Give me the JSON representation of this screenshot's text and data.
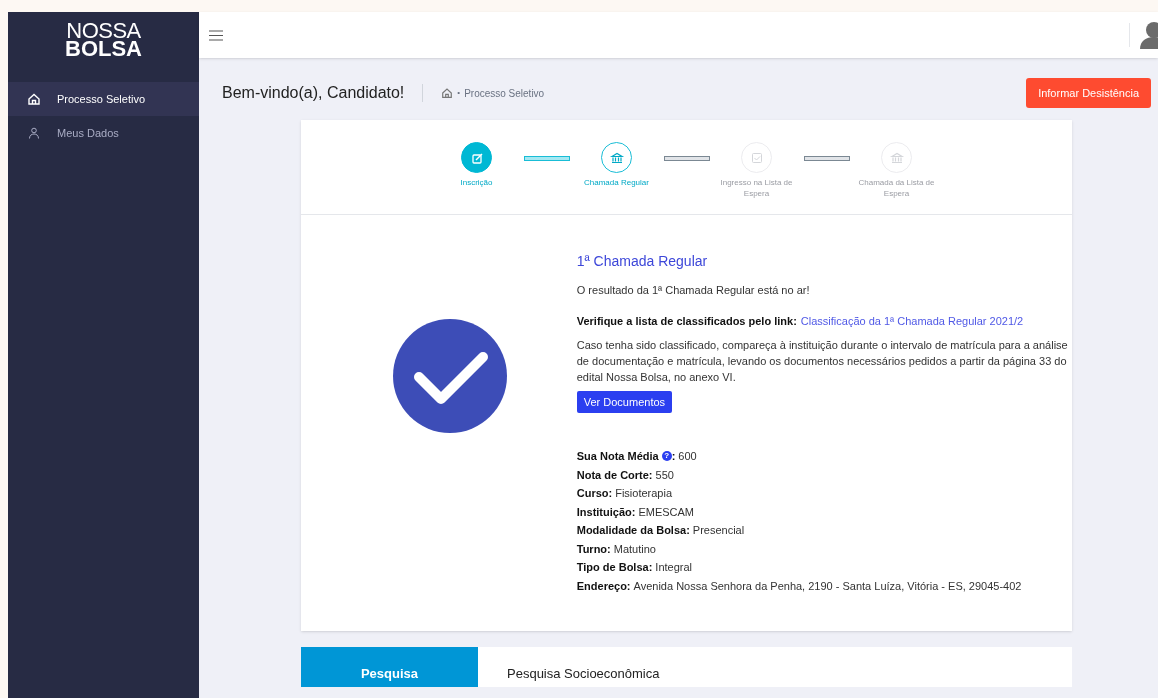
{
  "sidebar": {
    "logo": [
      "NOSSA",
      "BOLSA"
    ],
    "items": [
      {
        "label": "Processo Seletivo",
        "selected": true
      },
      {
        "label": "Meus Dados",
        "selected": false
      }
    ]
  },
  "header": {
    "title": "Bem-vindo(a), Candidato!",
    "breadcrumb_separator": "•",
    "breadcrumb": [
      "Processo Seletivo"
    ],
    "action": "Informar Desistência"
  },
  "steps": [
    {
      "label": "Inscrição",
      "kind": "done"
    },
    {
      "label": "Chamada Regular",
      "kind": "current"
    },
    {
      "label": "Ingresso na Lista de Espera",
      "kind": "pending"
    },
    {
      "label": "Chamada da Lista de Espera",
      "kind": "pending"
    }
  ],
  "result": {
    "title": "1ª Chamada Regular",
    "message": "O resultado da 1ª Chamada Regular está no ar!",
    "link_label": "Verifique a lista de classificados pelo link:",
    "link": "Classificação da 1ª Chamada Regular 2021/2",
    "instructions": "Caso tenha sido classificado, compareça à instituição durante o intervalo de matrícula para a análise de documentação e matrícula, levando os documentos necessários pedidos a partir da página 33 do edital Nossa Bolsa, no anexo VI.",
    "button": "Ver Documentos",
    "details": [
      {
        "label": "Sua Nota Média",
        "help": "?",
        "suffix": ":",
        "value": "600"
      },
      {
        "label": "Nota de Corte:",
        "value": "550"
      },
      {
        "label": "Curso:",
        "value": "Fisioterapia"
      },
      {
        "label": "Instituição:",
        "value": "EMESCAM"
      },
      {
        "label": "Modalidade da Bolsa:",
        "value": "Presencial"
      },
      {
        "label": "Turno:",
        "value": "Matutino"
      },
      {
        "label": "Tipo de Bolsa:",
        "value": "Integral"
      },
      {
        "label": "Endereço:",
        "value": "Avenida Nossa Senhora da Penha, 2190 - Santa Luíza, Vitória - ES, 29045-402"
      }
    ]
  },
  "next_section": {
    "tab": "Pesquisa",
    "title": "Pesquisa Socioeconômica"
  }
}
